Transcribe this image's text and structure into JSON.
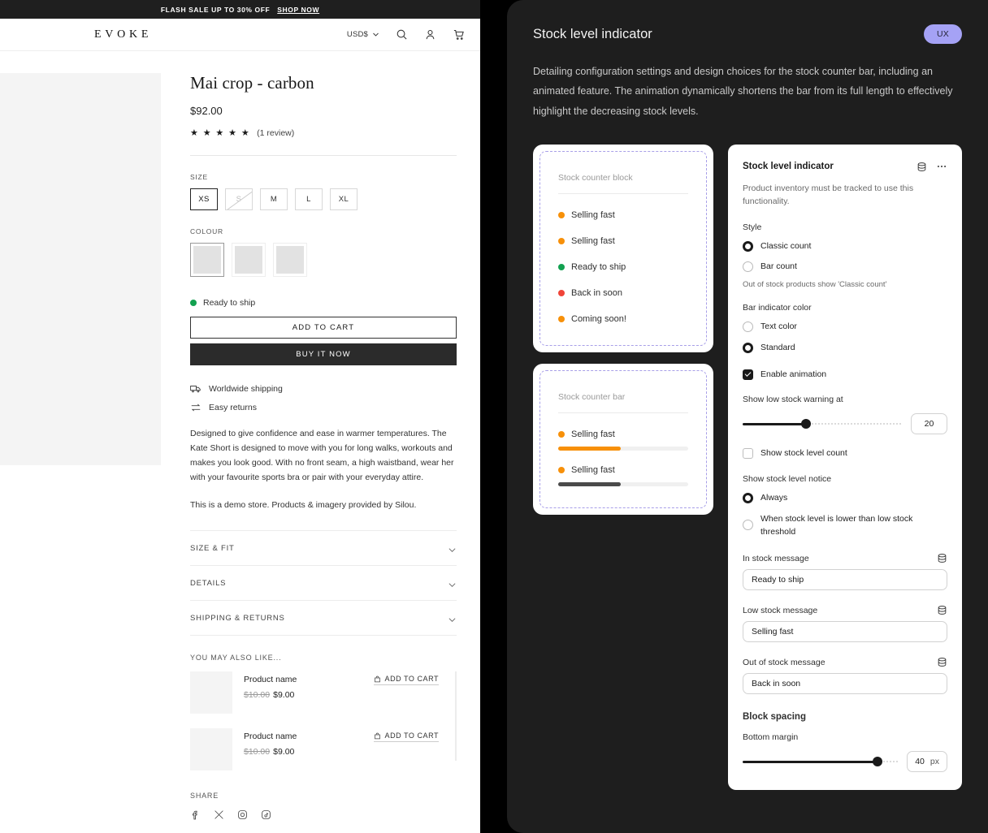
{
  "storefront": {
    "announcement": {
      "text": "FLASH SALE UP TO 30% OFF",
      "cta": "SHOP NOW"
    },
    "brand": "EVOKE",
    "header": {
      "currency": "USD$",
      "icons": [
        "chevron-down-icon",
        "search-icon",
        "account-icon",
        "cart-icon"
      ]
    },
    "product": {
      "title": "Mai crop - carbon",
      "price": "$92.00",
      "stars": "★ ★ ★ ★ ★",
      "review_count": "(1 review)",
      "size_label": "SIZE",
      "sizes": [
        {
          "label": "XS",
          "state": "selected"
        },
        {
          "label": "S",
          "state": "disabled"
        },
        {
          "label": "M",
          "state": "default"
        },
        {
          "label": "L",
          "state": "default"
        },
        {
          "label": "XL",
          "state": "default"
        }
      ],
      "colour_label": "COLOUR",
      "swatches": [
        "selected",
        "default",
        "default"
      ],
      "stock_status": {
        "text": "Ready to ship",
        "color": "#12a150"
      },
      "add_to_cart": "ADD TO CART",
      "buy_it_now": "BUY IT NOW",
      "perks": [
        {
          "icon": "truck-icon",
          "label": "Worldwide shipping"
        },
        {
          "icon": "returns-icon",
          "label": "Easy returns"
        }
      ],
      "description": "Designed to give confidence and ease in warmer temperatures. The Kate Short is designed to move with you for long walks, workouts and makes you look good. With no front seam, a high waistband, wear her with your favourite sports bra or pair with your everyday attire.",
      "demo_note": "This is a demo store. Products & imagery provided by Silou.",
      "accordions": [
        "SIZE & FIT",
        "DETAILS",
        "SHIPPING & RETURNS"
      ],
      "related_title": "YOU MAY ALSO LIKE...",
      "related": [
        {
          "name": "Product name",
          "old_price": "$10.00",
          "price": "$9.00",
          "cta": "ADD TO CART"
        },
        {
          "name": "Product name",
          "old_price": "$10.00",
          "price": "$9.00",
          "cta": "ADD TO CART"
        }
      ],
      "share_label": "SHARE",
      "share_icons": [
        "facebook-icon",
        "x-icon",
        "instagram-icon",
        "tiktok-icon"
      ]
    }
  },
  "spec": {
    "title": "Stock level indicator",
    "badge": "UX",
    "description": "Detailing configuration settings and design choices for the stock counter bar, including an animated feature. The animation dynamically shortens the bar from its full length to effectively highlight the decreasing stock levels.",
    "preview_block": {
      "heading": "Stock counter block",
      "items": [
        {
          "label": "Selling fast",
          "color": "#F79009"
        },
        {
          "label": "Selling fast",
          "color": "#F79009"
        },
        {
          "label": "Ready to ship",
          "color": "#12A150"
        },
        {
          "label": "Back in soon",
          "color": "#F04438"
        },
        {
          "label": "Coming soon!",
          "color": "#F79009"
        }
      ]
    },
    "preview_bar": {
      "heading": "Stock counter bar",
      "items": [
        {
          "label": "Selling fast",
          "color": "#F79009",
          "bar_color": "#F79009",
          "fill_percent": 48
        },
        {
          "label": "Selling fast",
          "color": "#F79009",
          "bar_color": "#4a4a4a",
          "fill_percent": 48
        }
      ]
    },
    "settings": {
      "title": "Stock level indicator",
      "note": "Product inventory must be tracked to use this functionality.",
      "style_label": "Style",
      "style_options": [
        {
          "label": "Classic count",
          "selected": true
        },
        {
          "label": "Bar count",
          "selected": false
        }
      ],
      "style_note": "Out of stock products show 'Classic count'",
      "bar_color_label": "Bar indicator color",
      "bar_color_options": [
        {
          "label": "Text color",
          "selected": false
        },
        {
          "label": "Standard",
          "selected": true
        }
      ],
      "enable_animation": {
        "label": "Enable animation",
        "checked": true
      },
      "low_stock_warning": {
        "label": "Show low stock warning at",
        "value": "20",
        "percent": 40
      },
      "show_stock_count": {
        "label": "Show stock level count",
        "checked": false
      },
      "notice_label": "Show stock level notice",
      "notice_options": [
        {
          "label": "Always",
          "selected": true
        },
        {
          "label": "When stock level is lower than low stock threshold",
          "selected": false
        }
      ],
      "in_stock": {
        "label": "In stock message",
        "value": "Ready to ship"
      },
      "low_stock": {
        "label": "Low stock message",
        "value": "Selling fast"
      },
      "out_of_stock": {
        "label": "Out of stock message",
        "value": "Back in soon"
      },
      "block_spacing_label": "Block spacing",
      "bottom_margin": {
        "label": "Bottom margin",
        "value": "40",
        "unit": "px",
        "percent": 87
      }
    }
  }
}
